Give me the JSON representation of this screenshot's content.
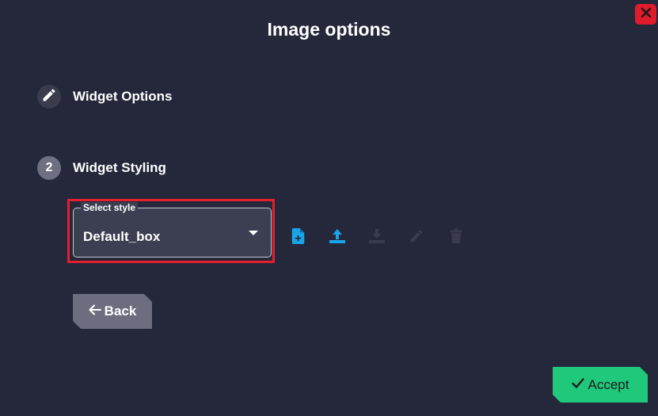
{
  "dialog": {
    "title": "Image options",
    "close_icon": "close-icon"
  },
  "steps": [
    {
      "icon": "pencil-icon",
      "label": "Widget Options"
    },
    {
      "number": "2",
      "label": "Widget Styling"
    }
  ],
  "style_select": {
    "legend": "Select style",
    "value": "Default_box",
    "icon": "chevron-down-icon"
  },
  "toolbar": {
    "icons": [
      "new-file-icon",
      "upload-icon",
      "download-icon",
      "edit-icon",
      "delete-icon"
    ],
    "active_color": "#1aa3e8",
    "disabled_color": "#3a3c4d"
  },
  "buttons": {
    "back_label": "Back",
    "accept_label": "Accept"
  },
  "colors": {
    "background": "#25273a",
    "highlight": "#e3202d",
    "accept": "#1fc87b",
    "close": "#e01b2b"
  }
}
